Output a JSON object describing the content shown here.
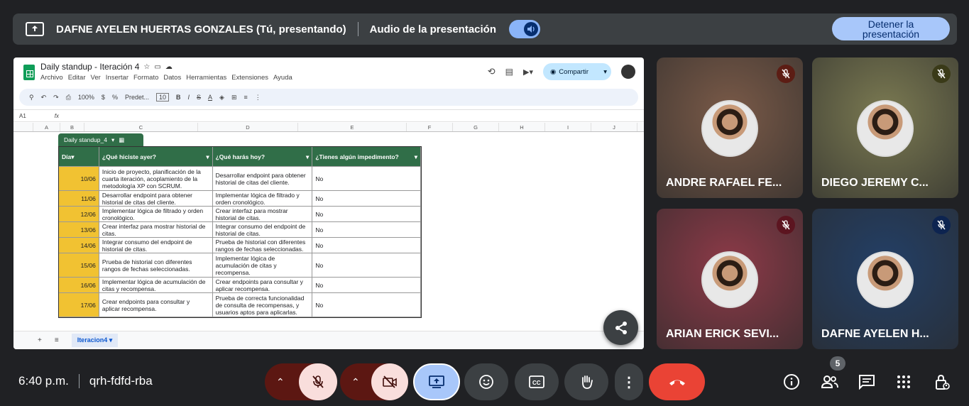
{
  "topbar": {
    "presenter": "DAFNE AYELEN HUERTAS GONZALES (Tú, presentando)",
    "audio_label": "Audio de la presentación",
    "stop_line1": "Detener la",
    "stop_line2": "presentación"
  },
  "sheet": {
    "title": "Daily standup - Iteración 4",
    "menus": [
      "Archivo",
      "Editar",
      "Ver",
      "Insertar",
      "Formato",
      "Datos",
      "Herramientas",
      "Extensiones",
      "Ayuda"
    ],
    "share_label": "Compartir",
    "zoom": "100%",
    "font": "Predet...",
    "font_size": "10",
    "cell_ref": "A1",
    "fx": "fx",
    "columns": [
      "A",
      "B",
      "C",
      "D",
      "E",
      "F",
      "G",
      "H",
      "I",
      "J"
    ],
    "table_name": "Daily standup_4",
    "headers": [
      "Día",
      "¿Qué hiciste ayer?",
      "¿Qué harás hoy?",
      "¿Tienes algún impedimento?"
    ],
    "rows": [
      {
        "n": "3",
        "day": "10/06",
        "ayer": "Inicio de proyecto, planificación de la cuarta iteración, acoplamiento de la metodología XP con SCRUM.",
        "hoy": "Desarrollar endpoint para obtener historial de citas del cliente.",
        "imp": "No"
      },
      {
        "n": "4",
        "day": "11/06",
        "ayer": "Desarrollar endpoint para obtener historial de citas del cliente.",
        "hoy": "Implementar lógica de filtrado y orden cronológico.",
        "imp": "No"
      },
      {
        "n": "5",
        "day": "12/06",
        "ayer": "Implementar lógica de filtrado y orden cronológico.",
        "hoy": "Crear interfaz para mostrar historial de citas.",
        "imp": "No"
      },
      {
        "n": "6",
        "day": "13/06",
        "ayer": "Crear interfaz para mostrar historial de citas.",
        "hoy": "Integrar consumo del endpoint de historial de citas.",
        "imp": "No"
      },
      {
        "n": "7",
        "day": "14/06",
        "ayer": "Integrar consumo del endpoint de historial de citas.",
        "hoy": "Prueba de historial con diferentes rangos de fechas seleccionadas.",
        "imp": "No"
      },
      {
        "n": "8",
        "day": "15/06",
        "ayer": "Prueba de historial con diferentes rangos de fechas seleccionadas.",
        "hoy": "Implementar lógica de acumulación de citas y recompensa.",
        "imp": "No"
      },
      {
        "n": "9",
        "day": "16/06",
        "ayer": "Implementar lógica de acumulación de citas y recompensa.",
        "hoy": "Crear endpoints para consultar y aplicar recompensa.",
        "imp": "No"
      },
      {
        "n": "10",
        "day": "17/06",
        "ayer": "Crear endpoints para consultar y aplicar recompensa.",
        "hoy": "Prueba de correcta funcionalidad de consulta de recompensas, y usuarios aptos para aplicarlas.",
        "imp": "No"
      }
    ],
    "sheet_tab": "Iteracion4"
  },
  "participants": [
    {
      "name": "ANDRE RAFAEL FE...",
      "bg": "#7a5a48",
      "mic": "#5c1d14"
    },
    {
      "name": "DIEGO JEREMY C...",
      "bg": "#7b7a52",
      "mic": "#3a3a18"
    },
    {
      "name": "ARIAN ERICK SEVI...",
      "bg": "#8d3a48",
      "mic": "#5c1520"
    },
    {
      "name": "DAFNE AYELEN H...",
      "bg": "#233f66",
      "mic": "#0d2450"
    }
  ],
  "bottom": {
    "time": "6:40 p.m.",
    "meeting_code": "qrh-fdfd-rba",
    "people_count": "5"
  },
  "colors": {
    "accent": "#8ab4f8",
    "danger": "#ea4335",
    "mic_off_bg": "#f9dedc",
    "present_bg": "#a8c7fa"
  }
}
